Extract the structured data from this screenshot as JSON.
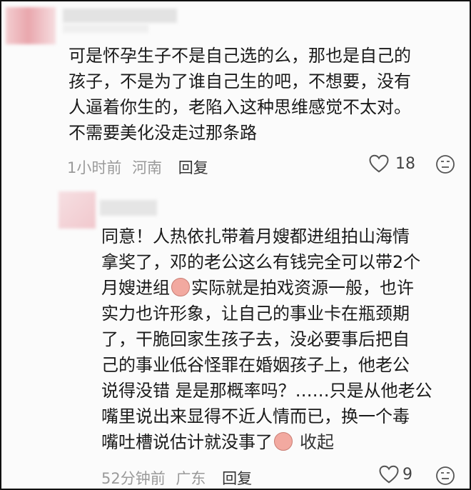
{
  "comment1": {
    "lines": [
      "可是怀孕生子不是自己选的么，那也是自己的",
      "孩子，不是为了谁自己生的吧，不想要，没有",
      "人逼着你生的，老陷入这种思维感觉不太对。",
      "不需要美化没走过那条路"
    ],
    "time": "1小时前",
    "location": "河南",
    "reply_label": "回复",
    "likes": "18"
  },
  "comment2": {
    "lines": [
      "同意！人热依扎带着月嫂都进组拍山海情",
      "拿奖了，邓的老公这么有钱完全可以带2个",
      "月嫂进组",
      "实际就是拍戏资源一般，也许",
      "实力也许形象，让自己的事业卡在瓶颈期",
      "了，干脆回家生孩子去，没必要事后把自",
      "己的事业低谷怪罪在婚姻孩子上，他老公",
      "说得没错 是是那概率吗？……只是从他老公",
      "嘴里说出来显得不近人情而已，换一个毒",
      "嘴吐槽说估计就没事了",
      "收起"
    ],
    "time": "52分钟前",
    "location": "广东",
    "reply_label": "回复",
    "likes": "9"
  }
}
